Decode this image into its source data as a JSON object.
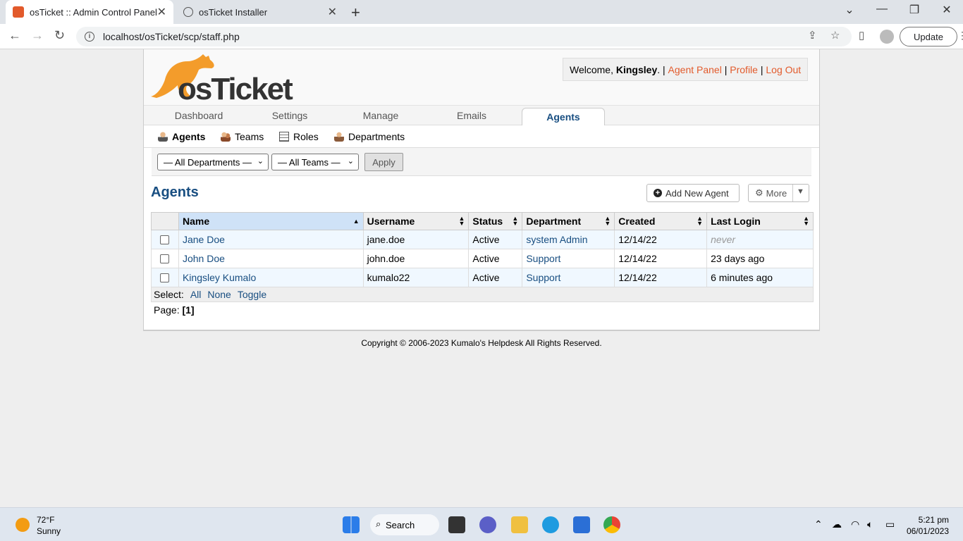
{
  "browser": {
    "tabs": [
      {
        "title": "osTicket :: Admin Control Panel",
        "active": true
      },
      {
        "title": "osTicket Installer",
        "active": false
      }
    ],
    "url": "localhost/osTicket/scp/staff.php",
    "update_label": "Update"
  },
  "header": {
    "logo_text": "osTicket",
    "welcome_prefix": "Welcome,",
    "user_name": "Kingsley",
    "agent_panel": "Agent Panel",
    "profile": "Profile",
    "logout": "Log Out"
  },
  "nav": {
    "tabs": [
      {
        "label": "Dashboard"
      },
      {
        "label": "Settings"
      },
      {
        "label": "Manage"
      },
      {
        "label": "Emails"
      },
      {
        "label": "Agents",
        "active": true
      }
    ],
    "subnav": [
      {
        "label": "Agents",
        "active": true
      },
      {
        "label": "Teams"
      },
      {
        "label": "Roles"
      },
      {
        "label": "Departments"
      }
    ]
  },
  "filters": {
    "department": "— All Departments —",
    "team": "— All Teams —",
    "apply": "Apply"
  },
  "main": {
    "title": "Agents",
    "add_button": "Add New Agent",
    "more_button": "More"
  },
  "table": {
    "columns": [
      "Name",
      "Username",
      "Status",
      "Department",
      "Created",
      "Last Login"
    ],
    "rows": [
      {
        "name": "Jane Doe",
        "username": "jane.doe",
        "status": "Active",
        "department": "system Admin",
        "created": "12/14/22",
        "last_login": "never"
      },
      {
        "name": "John Doe",
        "username": "john.doe",
        "status": "Active",
        "department": "Support",
        "created": "12/14/22",
        "last_login": "23 days ago"
      },
      {
        "name": "Kingsley Kumalo",
        "username": "kumalo22",
        "status": "Active",
        "department": "Support",
        "created": "12/14/22",
        "last_login": "6 minutes ago"
      }
    ],
    "select_label": "Select:",
    "select_all": "All",
    "select_none": "None",
    "select_toggle": "Toggle",
    "page_label": "Page:",
    "page_current": "[1]"
  },
  "footer": "Copyright © 2006-2023 Kumalo's Helpdesk All Rights Reserved.",
  "taskbar": {
    "temp": "72°F",
    "condition": "Sunny",
    "search": "Search",
    "time": "5:21 pm",
    "date": "06/01/2023"
  },
  "colors": {
    "link": "#184e81",
    "accent": "#e25a2b",
    "logo_orange": "#f39c2b"
  }
}
